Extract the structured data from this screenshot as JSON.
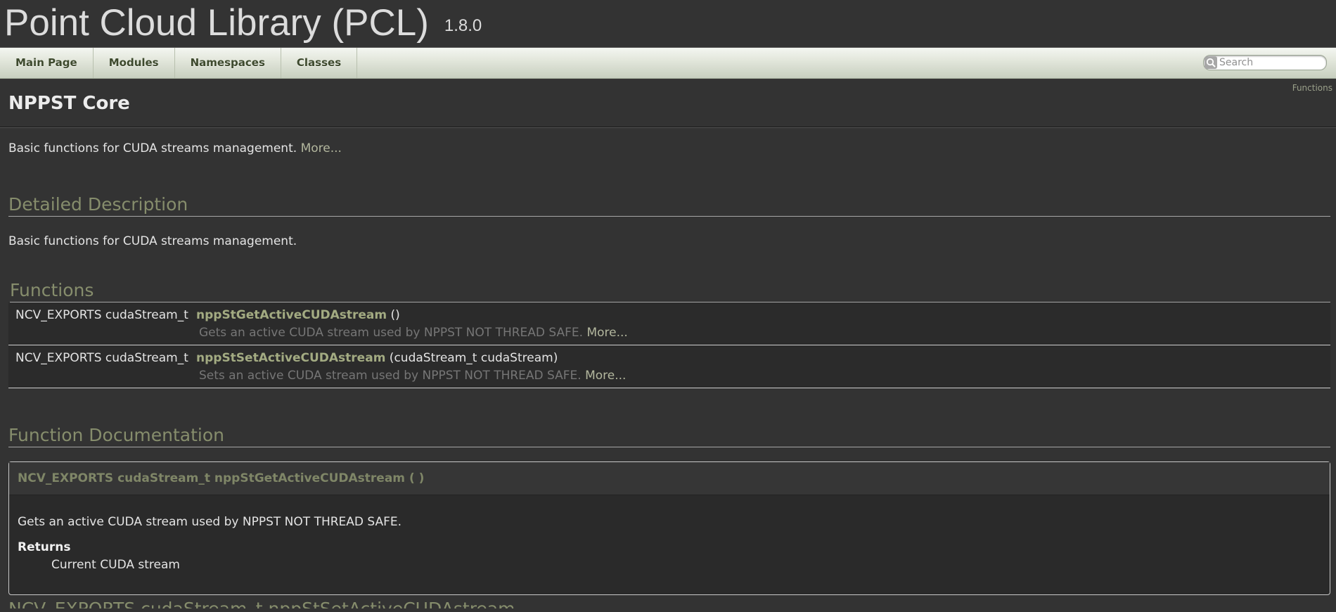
{
  "project": {
    "name": "Point Cloud Library (PCL)",
    "version": "1.8.0"
  },
  "nav": {
    "tabs": [
      "Main Page",
      "Modules",
      "Namespaces",
      "Classes"
    ],
    "search_placeholder": "Search"
  },
  "header": {
    "summary_link": "Functions",
    "title": "NPPST Core"
  },
  "brief": {
    "text": "Basic functions for CUDA streams management.",
    "more": "More..."
  },
  "detailed": {
    "heading": "Detailed Description",
    "text": "Basic functions for CUDA streams management."
  },
  "functions": {
    "heading": "Functions",
    "rows": [
      {
        "return_type": "NCV_EXPORTS cudaStream_t",
        "name": "nppStGetActiveCUDAstream",
        "args": " ()",
        "desc": "Gets an active CUDA stream used by NPPST NOT THREAD SAFE.",
        "more": "More..."
      },
      {
        "return_type": "NCV_EXPORTS cudaStream_t",
        "name": "nppStSetActiveCUDAstream",
        "args": " (cudaStream_t cudaStream)",
        "desc": "Sets an active CUDA stream used by NPPST NOT THREAD SAFE.",
        "more": "More..."
      }
    ]
  },
  "function_doc": {
    "heading": "Function Documentation",
    "proto": "NCV_EXPORTS cudaStream_t nppStGetActiveCUDAstream (  )",
    "text": "Gets an active CUDA stream used by NPPST NOT THREAD SAFE.",
    "returns_label": "Returns",
    "returns_value": "Current CUDA stream"
  },
  "next_heading_partial": "NCV_EXPORTS cudaStream_t nppStSetActiveCUDAstream"
}
